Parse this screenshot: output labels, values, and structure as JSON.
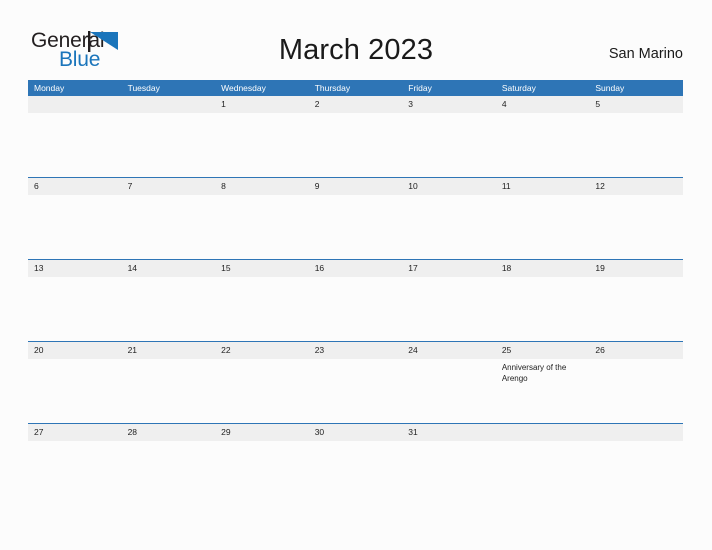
{
  "brand": {
    "name_part1": "General",
    "name_part2": "Blue",
    "flag_icon": "blue-triangle-flag-icon",
    "color_primary": "#1b75bb",
    "color_text": "#231f20"
  },
  "header": {
    "title": "March 2023",
    "region": "San Marino"
  },
  "theme": {
    "header_blue": "#2e75b6",
    "band_gray": "#efefef",
    "page_background": "#fcfcfc",
    "text_dark": "#222222"
  },
  "calendar": {
    "month": "March",
    "year": "2023",
    "weekday_headers": [
      "Monday",
      "Tuesday",
      "Wednesday",
      "Thursday",
      "Friday",
      "Saturday",
      "Sunday"
    ],
    "weeks": [
      {
        "days": [
          {
            "num": "",
            "event": ""
          },
          {
            "num": "",
            "event": ""
          },
          {
            "num": "1",
            "event": ""
          },
          {
            "num": "2",
            "event": ""
          },
          {
            "num": "3",
            "event": ""
          },
          {
            "num": "4",
            "event": ""
          },
          {
            "num": "5",
            "event": ""
          }
        ]
      },
      {
        "days": [
          {
            "num": "6",
            "event": ""
          },
          {
            "num": "7",
            "event": ""
          },
          {
            "num": "8",
            "event": ""
          },
          {
            "num": "9",
            "event": ""
          },
          {
            "num": "10",
            "event": ""
          },
          {
            "num": "11",
            "event": ""
          },
          {
            "num": "12",
            "event": ""
          }
        ]
      },
      {
        "days": [
          {
            "num": "13",
            "event": ""
          },
          {
            "num": "14",
            "event": ""
          },
          {
            "num": "15",
            "event": ""
          },
          {
            "num": "16",
            "event": ""
          },
          {
            "num": "17",
            "event": ""
          },
          {
            "num": "18",
            "event": ""
          },
          {
            "num": "19",
            "event": ""
          }
        ]
      },
      {
        "days": [
          {
            "num": "20",
            "event": ""
          },
          {
            "num": "21",
            "event": ""
          },
          {
            "num": "22",
            "event": ""
          },
          {
            "num": "23",
            "event": ""
          },
          {
            "num": "24",
            "event": ""
          },
          {
            "num": "25",
            "event": "Anniversary of the Arengo"
          },
          {
            "num": "26",
            "event": ""
          }
        ]
      },
      {
        "days": [
          {
            "num": "27",
            "event": ""
          },
          {
            "num": "28",
            "event": ""
          },
          {
            "num": "29",
            "event": ""
          },
          {
            "num": "30",
            "event": ""
          },
          {
            "num": "31",
            "event": ""
          },
          {
            "num": "",
            "event": ""
          },
          {
            "num": "",
            "event": ""
          }
        ]
      }
    ]
  }
}
